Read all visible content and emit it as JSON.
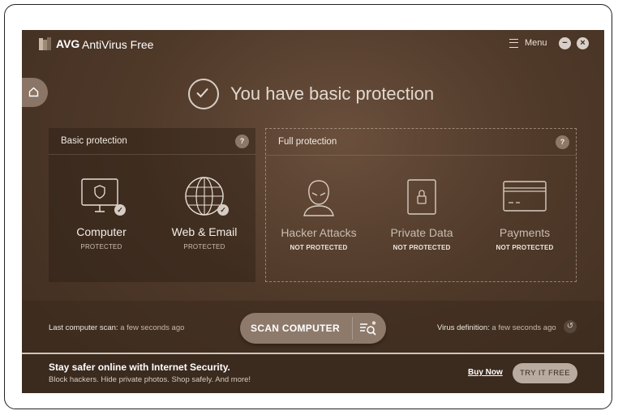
{
  "window": {
    "brand": "AVG",
    "product": "AntiVirus Free",
    "menu_label": "Menu",
    "minimize_glyph": "−",
    "close_glyph": "×"
  },
  "hero": {
    "title": "You have basic protection"
  },
  "basic_protection": {
    "title": "Basic protection",
    "help": "?",
    "items": [
      {
        "label": "Computer",
        "status": "PROTECTED",
        "icon": "monitor-shield-icon"
      },
      {
        "label": "Web & Email",
        "status": "PROTECTED",
        "icon": "globe-icon"
      }
    ]
  },
  "full_protection": {
    "title": "Full protection",
    "help": "?",
    "items": [
      {
        "label": "Hacker Attacks",
        "status": "NOT PROTECTED",
        "icon": "hacker-icon"
      },
      {
        "label": "Private Data",
        "status": "NOT PROTECTED",
        "icon": "lock-icon"
      },
      {
        "label": "Payments",
        "status": "NOT PROTECTED",
        "icon": "credit-card-icon"
      }
    ]
  },
  "scan_bar": {
    "last_scan_label": "Last computer scan:",
    "last_scan_value": "a few seconds ago",
    "scan_button": "SCAN COMPUTER",
    "virus_def_label": "Virus definition:",
    "virus_def_value": "a few seconds ago"
  },
  "promo": {
    "title": "Stay safer online with Internet Security.",
    "subtitle": "Block hackers. Hide private photos. Shop safely. And more!",
    "buy_now": "Buy Now",
    "try_free": "TRY IT FREE"
  },
  "colors": {
    "background": "#4f3929",
    "accent_button": "#8e7a6b",
    "promo_bar": "#3b2a1e"
  }
}
